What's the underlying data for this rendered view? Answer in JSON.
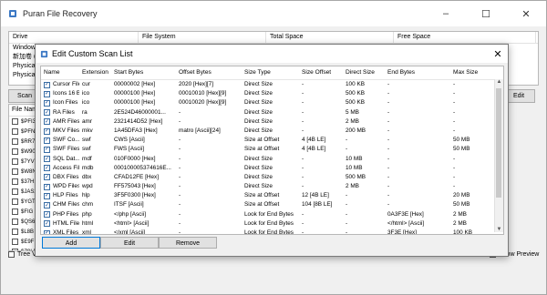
{
  "app": {
    "title": "Puran File Recovery"
  },
  "window_controls": {
    "minimize": "–",
    "maximize": "☐",
    "close": "✕"
  },
  "drive_panel": {
    "columns": [
      "Drive",
      "File System",
      "Total Space",
      "Free Space"
    ],
    "rows": [
      "Windows (C:)",
      "新加卷 (E:)",
      "Physical D",
      "Physical D"
    ]
  },
  "main_buttons": {
    "scan": "Scan",
    "edit": "Edit"
  },
  "file_list": {
    "header": "File Name",
    "rows": [
      "$PFI3",
      "$PFNI",
      "$RR7",
      "$W90",
      "$7YV",
      "$W8N",
      "$37H1",
      "$JAS2",
      "$YGT",
      "$FIG",
      "$QS6",
      "$L8B",
      "$E9F",
      "$Z9LE"
    ]
  },
  "bottom_options": {
    "tree_view": "Tree Vi",
    "show_preview": "Show Preview"
  },
  "dialog": {
    "title": "Edit Custom Scan List",
    "close": "✕",
    "columns": [
      "Name",
      "Extension",
      "Start Bytes",
      "Offset Bytes",
      "Size Type",
      "Size Offset",
      "Direct Size",
      "End Bytes",
      "Max Size"
    ],
    "rows": [
      {
        "name": "Cursor Files",
        "ext": "cur",
        "start": "00000002 [Hex]",
        "offset": "2020 [Hex][7]",
        "size_type": "Direct Size",
        "size_offset": "-",
        "direct": "100 KB",
        "end": "-",
        "max": "-"
      },
      {
        "name": "Icons 16 Bit",
        "ext": "ico",
        "start": "00000100 [Hex]",
        "offset": "00010010 [Hex][9]",
        "size_type": "Direct Size",
        "size_offset": "-",
        "direct": "500 KB",
        "end": "-",
        "max": "-"
      },
      {
        "name": "Icon Files",
        "ext": "ico",
        "start": "00000100 [Hex]",
        "offset": "00010020 [Hex][9]",
        "size_type": "Direct Size",
        "size_offset": "-",
        "direct": "500 KB",
        "end": "-",
        "max": "-"
      },
      {
        "name": "RA Files",
        "ext": "ra",
        "start": "2E524D46000001...",
        "offset": "-",
        "size_type": "Direct Size",
        "size_offset": "-",
        "direct": "5 MB",
        "end": "-",
        "max": "-"
      },
      {
        "name": "AMR Files",
        "ext": "amr",
        "start": "2321414D52 [Hex]",
        "offset": "-",
        "size_type": "Direct Size",
        "size_offset": "-",
        "direct": "2 MB",
        "end": "-",
        "max": "-"
      },
      {
        "name": "MKV Files",
        "ext": "mkv",
        "start": "1A45DFA3 [Hex]",
        "offset": "matro [Ascii][24]",
        "size_type": "Direct Size",
        "size_offset": "-",
        "direct": "200 MB",
        "end": "-",
        "max": "-"
      },
      {
        "name": "SWF Co...",
        "ext": "swf",
        "start": "CWS [Ascii]",
        "offset": "-",
        "size_type": "Size at Offset",
        "size_offset": "4 [4B LE]",
        "direct": "-",
        "end": "-",
        "max": "50 MB"
      },
      {
        "name": "SWF Files",
        "ext": "swf",
        "start": "FWS [Ascii]",
        "offset": "-",
        "size_type": "Size at Offset",
        "size_offset": "4 [4B LE]",
        "direct": "-",
        "end": "-",
        "max": "50 MB"
      },
      {
        "name": "SQL Dat...",
        "ext": "mdf",
        "start": "010F0000 [Hex]",
        "offset": "-",
        "size_type": "Direct Size",
        "size_offset": "-",
        "direct": "10 MB",
        "end": "-",
        "max": "-"
      },
      {
        "name": "Access Files",
        "ext": "mdb",
        "start": "000100005374616E...",
        "offset": "-",
        "size_type": "Direct Size",
        "size_offset": "-",
        "direct": "10 MB",
        "end": "-",
        "max": "-"
      },
      {
        "name": "DBX Files",
        "ext": "dbx",
        "start": "CFAD12FE [Hex]",
        "offset": "-",
        "size_type": "Direct Size",
        "size_offset": "-",
        "direct": "500 MB",
        "end": "-",
        "max": "-"
      },
      {
        "name": "WPD Files",
        "ext": "wpd",
        "start": "FF575043 [Hex]",
        "offset": "-",
        "size_type": "Direct Size",
        "size_offset": "-",
        "direct": "2 MB",
        "end": "-",
        "max": "-"
      },
      {
        "name": "HLP Files",
        "ext": "hlp",
        "start": "3F5F0300 [Hex]",
        "offset": "-",
        "size_type": "Size at Offset",
        "size_offset": "12 [4B LE]",
        "direct": "-",
        "end": "-",
        "max": "20 MB"
      },
      {
        "name": "CHM Files",
        "ext": "chm",
        "start": "ITSF [Ascii]",
        "offset": "-",
        "size_type": "Size at Offset",
        "size_offset": "104 [8B LE]",
        "direct": "-",
        "end": "-",
        "max": "50 MB"
      },
      {
        "name": "PHP Files",
        "ext": "php",
        "start": "</php [Ascii]",
        "offset": "-",
        "size_type": "Look for End Bytes",
        "size_offset": "-",
        "direct": "-",
        "end": "0A3F3E [Hex]",
        "max": "2 MB"
      },
      {
        "name": "HTML Files",
        "ext": "html",
        "start": "<html> [Ascii]",
        "offset": "-",
        "size_type": "Look for End Bytes",
        "size_offset": "-",
        "direct": "-",
        "end": "</html> [Ascii]",
        "max": "2 MB"
      },
      {
        "name": "XML Files",
        "ext": "xml",
        "start": "</xml [Ascii]",
        "offset": "-",
        "size_type": "Look for End Bytes",
        "size_offset": "-",
        "direct": "-",
        "end": "3F3E [Hex]",
        "max": "100 KB"
      }
    ],
    "buttons": {
      "add": "Add",
      "edit": "Edit",
      "remove": "Remove"
    }
  }
}
